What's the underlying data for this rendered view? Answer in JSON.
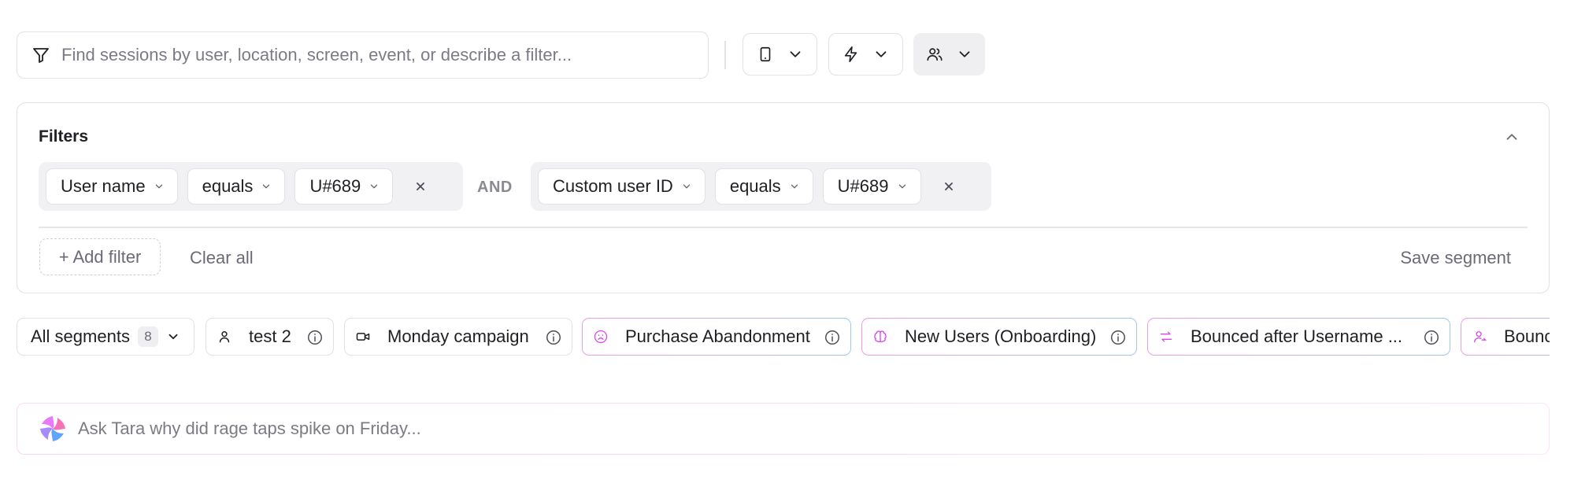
{
  "search": {
    "placeholder": "Find sessions by user, location, screen, event, or describe a filter...",
    "icon": "filter-icon"
  },
  "toolbar": [
    {
      "name": "device-filter-button",
      "icon": "mobile-device-icon"
    },
    {
      "name": "event-filter-button",
      "icon": "lightning-icon"
    },
    {
      "name": "user-filter-button",
      "icon": "users-icon",
      "active": true
    }
  ],
  "filters": {
    "title": "Filters",
    "conjunction": "AND",
    "groups": [
      {
        "field": "User name",
        "operator": "equals",
        "value": "U#689"
      },
      {
        "field": "Custom user ID",
        "operator": "equals",
        "value": "U#689"
      }
    ],
    "add_filter": "+ Add filter",
    "clear_all": "Clear all",
    "save_segment": "Save segment"
  },
  "segments": {
    "all_label": "All segments",
    "count": "8",
    "items": [
      {
        "label": "test 2",
        "icon": "user-icon",
        "accent": "#e1e1e6"
      },
      {
        "label": "Monday campaign",
        "icon": "video-icon",
        "accent": "#e1e1e6"
      },
      {
        "label": "Purchase Abandonment",
        "icon": "sad-face-icon",
        "accent": "#d946ef"
      },
      {
        "label": "New Users (Onboarding)",
        "icon": "brain-icon",
        "accent": "#d946ef"
      },
      {
        "label": "Bounced after Username ...",
        "icon": "bounce-arrows-icon",
        "accent": "#d946ef"
      },
      {
        "label": "Bounce",
        "icon": "user-bounce-icon",
        "accent": "#d946ef"
      }
    ]
  },
  "assistant": {
    "placeholder": "Ask Tara why did rage taps spike on Friday...",
    "icon": "tara-logo-icon"
  },
  "colors": {
    "border": "#e1e1e6",
    "muted_text": "#6b6b75",
    "accent_pink": "#e879f9",
    "accent_blue": "#60a5fa"
  }
}
